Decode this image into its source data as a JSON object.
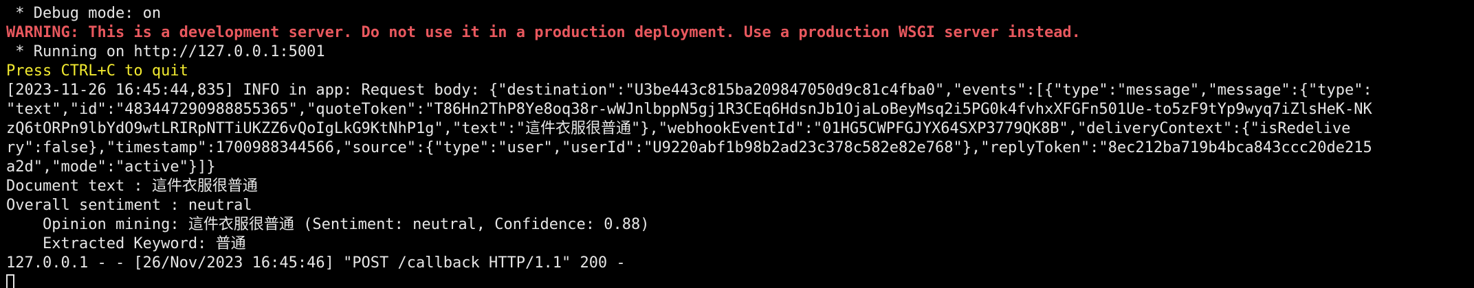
{
  "colors": {
    "background": "#000000",
    "default_text": "#e6e6e6",
    "warning": "#e8585e",
    "quit_hint": "#f2ea30"
  },
  "terminal": {
    "lines": [
      " * Debug mode: on",
      "WARNING: This is a development server. Do not use it in a production deployment. Use a production WSGI server instead.",
      " * Running on http://127.0.0.1:5001",
      "Press CTRL+C to quit",
      "[2023-11-26 16:45:44,835] INFO in app: Request body: {\"destination\":\"U3be443c815ba209847050d9c81c4fba0\",\"events\":[{\"type\":\"message\",\"message\":{\"type\":",
      "\"text\",\"id\":\"483447290988855365\",\"quoteToken\":\"T86Hn2ThP8Ye8oq38r-wWJnlbppN5gj1R3CEq6HdsnJb1OjaLoBeyMsq2i5PG0k4fvhxXFGFn501Ue-to5zF9tYp9wyq7iZlsHeK-NK",
      "zQ6tORPn9lbYdO9wtLRIRpNTTiUKZZ6vQoIgLkG9KtNhP1g\",\"text\":\"這件衣服很普通\"},\"webhookEventId\":\"01HG5CWPFGJYX64SXP3779QK8B\",\"deliveryContext\":{\"isRedelive",
      "ry\":false},\"timestamp\":1700988344566,\"source\":{\"type\":\"user\",\"userId\":\"U9220abf1b98b2ad23c378c582e82e768\"},\"replyToken\":\"8ec212ba719b4bca843ccc20de215",
      "a2d\",\"mode\":\"active\"}]}",
      "Document text : 這件衣服很普通",
      "Overall sentiment : neutral",
      "    Opinion mining: 這件衣服很普通 (Sentiment: neutral, Confidence: 0.88)",
      "    Extracted Keyword: 普通",
      "127.0.0.1 - - [26/Nov/2023 16:45:46] \"POST /callback HTTP/1.1\" 200 -"
    ]
  }
}
